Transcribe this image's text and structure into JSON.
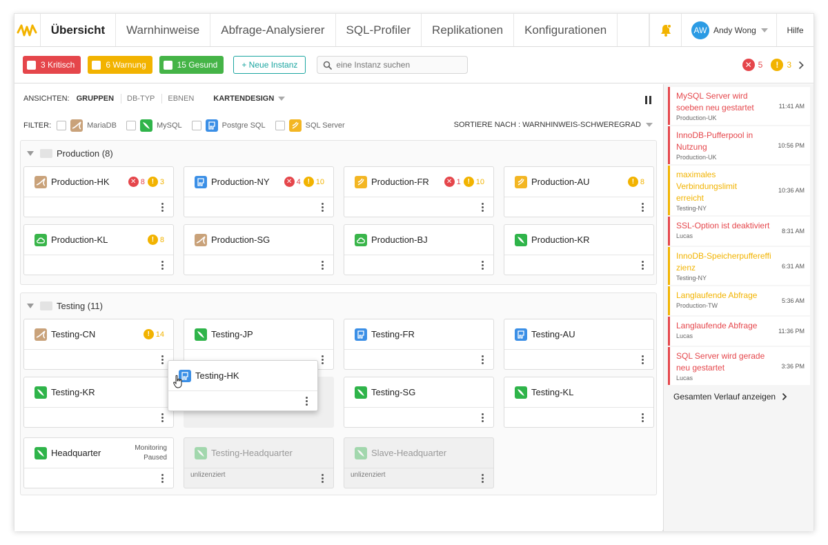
{
  "nav": {
    "tabs": [
      "Übersicht",
      "Warnhinweise",
      "Abfrage-Analysierer",
      "SQL-Profiler",
      "Replikationen",
      "Konfigurationen"
    ],
    "user_initials": "AW",
    "user_name": "Andy Wong",
    "help": "Hilfe"
  },
  "toolbar": {
    "critical": "3 Kritisch",
    "warning": "6 Warnung",
    "healthy": "15 Gesund",
    "new_instance": "+ Neue Instanz",
    "search_placeholder": "eine Instanz suchen",
    "critical_count": "5",
    "warning_count": "3"
  },
  "views": {
    "label": "ANSICHTEN:",
    "options": [
      "GRUPPEN",
      "DB-TYP",
      "EBNEN"
    ],
    "design": "KARTENDESIGN"
  },
  "filters": {
    "label": "FILTER:",
    "items": [
      "MariaDB",
      "MySQL",
      "Postgre SQL",
      "SQL Server"
    ],
    "sort": "SORTIERE NACH : WARNHINWEIS-SCHWEREGRAD"
  },
  "groups": {
    "production": {
      "title": "Production (8)",
      "cards": [
        {
          "name": "Production-HK",
          "err": "8",
          "warn": "3"
        },
        {
          "name": "Production-NY",
          "err": "4",
          "warn": "10"
        },
        {
          "name": "Production-FR",
          "err": "1",
          "warn": "10"
        },
        {
          "name": "Production-AU",
          "warn": "8"
        },
        {
          "name": "Production-KL",
          "warn": "8"
        },
        {
          "name": "Production-SG"
        },
        {
          "name": "Production-BJ"
        },
        {
          "name": "Production-KR"
        }
      ]
    },
    "testing": {
      "title": "Testing (11)",
      "cards": [
        {
          "name": "Testing-CN",
          "warn": "14"
        },
        {
          "name": "Testing-JP"
        },
        {
          "name": "Testing-FR"
        },
        {
          "name": "Testing-AU"
        },
        {
          "name": "Testing-KR"
        },
        {
          "name": "Testing-HK"
        },
        {
          "name": "Testing-SG"
        },
        {
          "name": "Testing-KL"
        },
        {
          "name": "Headquarter",
          "status_line1": "Monitoring",
          "status_line2": "Paused"
        },
        {
          "name": "Testing-Headquarter",
          "note": "unlizenziert"
        },
        {
          "name": "Slave-Headquarter",
          "note": "unlizenziert"
        }
      ]
    }
  },
  "events": [
    {
      "title": "MySQL Server wird soeben neu gestartet",
      "source": "Production-UK",
      "time": "11:41 AM",
      "level": "critical"
    },
    {
      "title": "InnoDB-Pufferpool in Nutzung",
      "source": "Production-UK",
      "time": "10:56 PM",
      "level": "critical"
    },
    {
      "title": "maximales Verbindungslimit erreicht",
      "source": "Testing-NY",
      "time": "10:36 AM",
      "level": "warning"
    },
    {
      "title": "SSL-Option ist deaktiviert",
      "source": "Lucas",
      "time": "8:31 AM",
      "level": "critical"
    },
    {
      "title": "InnoDB-Speicherpuffereffizienz",
      "source": "Testing-NY",
      "time": "6:31 AM",
      "level": "warning"
    },
    {
      "title": "Langlaufende Abfrage",
      "source": "Production-TW",
      "time": "5:36 AM",
      "level": "warning"
    },
    {
      "title": "Langlaufende Abfrage",
      "source": "Lucas",
      "time": "11:36 PM",
      "level": "critical"
    },
    {
      "title": "SQL Server wird gerade neu gestartet",
      "source": "Lucas",
      "time": "3:36 PM",
      "level": "critical"
    }
  ],
  "history": "Gesamten Verlauf anzeigen",
  "colors": {
    "critical": "#e5464b",
    "warning": "#f2b300",
    "healthy": "#45b447",
    "accent": "#1aa5a0",
    "avatar": "#2b9be4"
  },
  "icons": {
    "mysql": "dolphin-icon",
    "mariadb": "seal-icon",
    "postgres": "elephant-icon",
    "sqlserver": "sqlserver-icon",
    "cloud": "cloud-icon"
  }
}
